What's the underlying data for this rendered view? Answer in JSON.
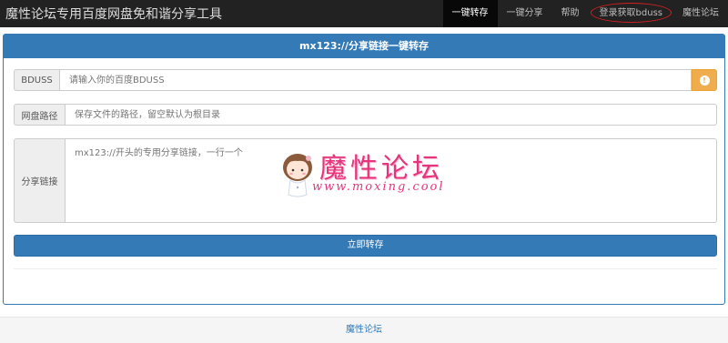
{
  "navbar": {
    "brand": "魔性论坛专用百度网盘免和谐分享工具",
    "items": [
      {
        "label": "一键转存"
      },
      {
        "label": "一键分享"
      },
      {
        "label": "帮助"
      },
      {
        "label": "登录获取bduss"
      },
      {
        "label": "魔性论坛"
      }
    ]
  },
  "panel": {
    "title": "mx123://分享链接一键转存",
    "bduss": {
      "label": "BDUSS",
      "placeholder": "请输入你的百度BDUSS",
      "icon": "exclamation-circle-icon"
    },
    "path": {
      "label": "网盘路径",
      "placeholder": "保存文件的路径，留空默认为根目录"
    },
    "links": {
      "label": "分享链接",
      "placeholder": "mx123://开头的专用分享链接，一行一个"
    },
    "submit_label": "立即转存"
  },
  "watermark": {
    "title": "魔性论坛",
    "url": "www.moxing.cool"
  },
  "footer": {
    "link": "魔性论坛"
  },
  "colors": {
    "navbar_bg": "#222222",
    "primary": "#337ab7",
    "warning": "#f0ad4e",
    "highlight_ring": "#d42020",
    "watermark": "#e6357d"
  }
}
